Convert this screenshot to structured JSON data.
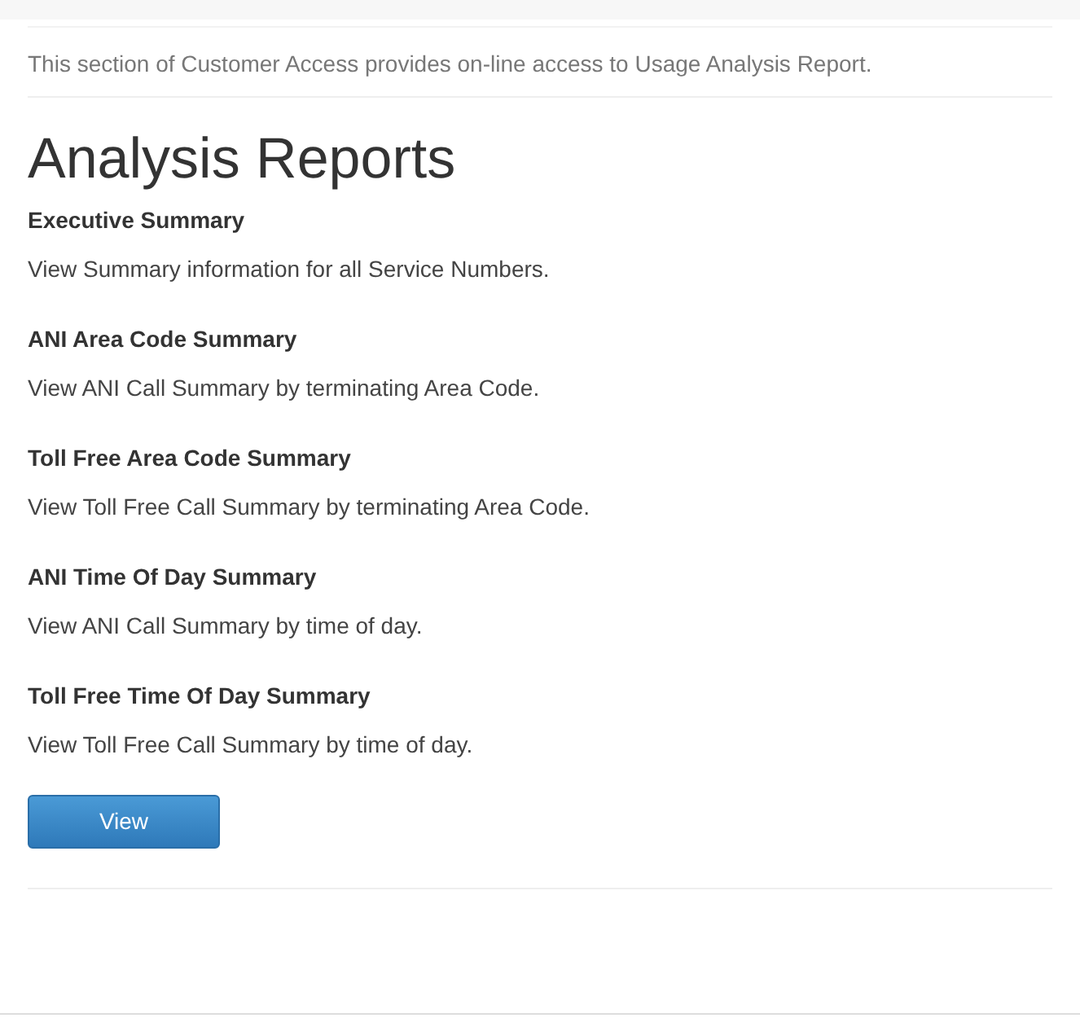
{
  "intro": "This section of Customer Access provides on-line access to Usage Analysis Report.",
  "heading": "Analysis Reports",
  "reports": [
    {
      "title": "Executive Summary",
      "description": "View Summary information for all Service Numbers."
    },
    {
      "title": "ANI Area Code Summary",
      "description": "View ANI Call Summary by terminating Area Code."
    },
    {
      "title": "Toll Free Area Code Summary",
      "description": "View Toll Free Call Summary by terminating Area Code."
    },
    {
      "title": "ANI Time Of Day Summary",
      "description": "View ANI Call Summary by time of day."
    },
    {
      "title": "Toll Free Time Of Day Summary",
      "description": "View Toll Free Call Summary by time of day."
    }
  ],
  "button": "View"
}
